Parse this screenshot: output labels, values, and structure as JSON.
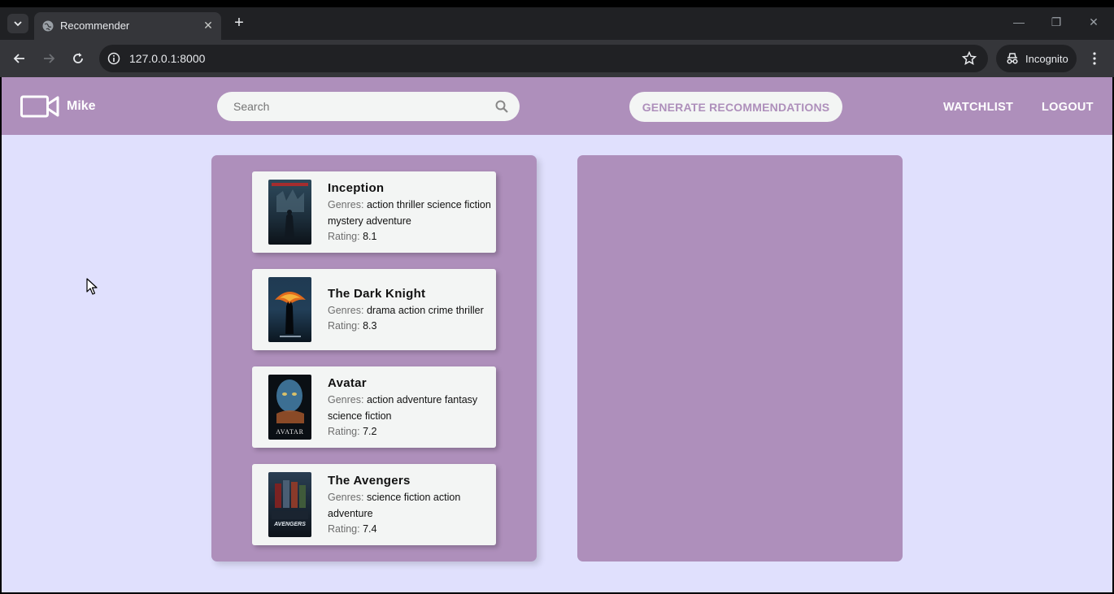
{
  "browser": {
    "tab_title": "Recommender",
    "url": "127.0.0.1:8000",
    "incognito_label": "Incognito"
  },
  "navbar": {
    "brand_name": "Mike",
    "search_placeholder": "Search",
    "generate_label": "GENERATE RECOMMENDATIONS",
    "watchlist_label": "WATCHLIST",
    "logout_label": "LOGOUT"
  },
  "labels": {
    "genres": "Genres:",
    "rating": "Rating:"
  },
  "movies": [
    {
      "title": "Inception",
      "genres": "action thriller science fiction mystery adventure",
      "rating": "8.1"
    },
    {
      "title": "The Dark Knight",
      "genres": "drama action crime thriller",
      "rating": "8.3"
    },
    {
      "title": "Avatar",
      "genres": "action adventure fantasy science fiction",
      "rating": "7.2"
    },
    {
      "title": "The Avengers",
      "genres": "science fiction action adventure",
      "rating": "7.4"
    }
  ],
  "posters": {
    "avatar_text": "AVATAR",
    "avengers_text": "AVENGERS"
  },
  "colors": {
    "accent": "#ae8fbb",
    "page_bg": "#e0e0fd",
    "card_bg": "#f3f5f4"
  }
}
